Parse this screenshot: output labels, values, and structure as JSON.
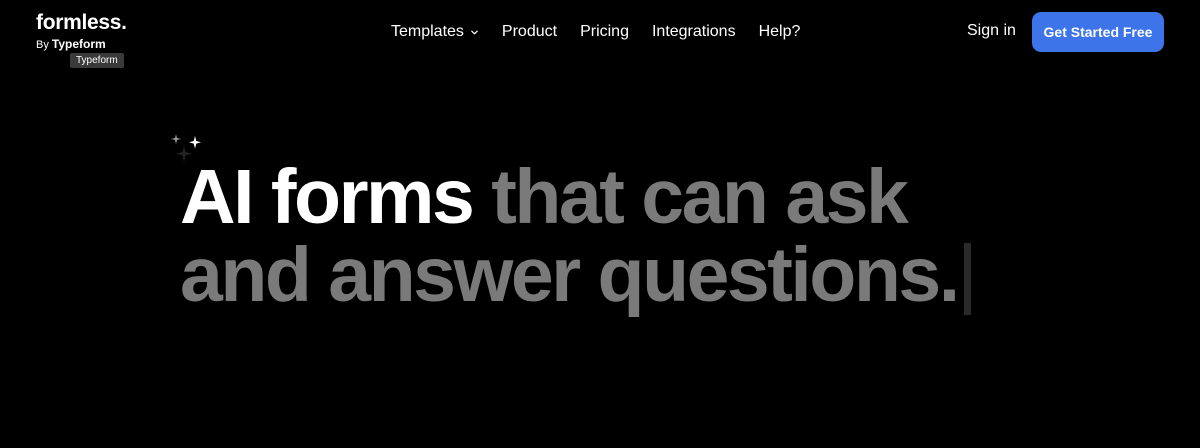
{
  "header": {
    "logo": {
      "word": "formless.",
      "by_prefix": "By",
      "by_brand": "Typeform",
      "tooltip": "Typeform"
    },
    "nav": [
      {
        "label": "Templates",
        "has_dropdown": true
      },
      {
        "label": "Product"
      },
      {
        "label": "Pricing"
      },
      {
        "label": "Integrations"
      },
      {
        "label": "Help?"
      }
    ],
    "sign_in_label": "Sign in",
    "cta_label": "Get Started Free"
  },
  "hero": {
    "line1_bright": "AI forms",
    "line1_dim": "that can ask",
    "line2_dim": "and answer questions."
  },
  "colors": {
    "background": "#000000",
    "text": "#ffffff",
    "text_dim": "#7a7a7a",
    "accent": "#3d74ea"
  },
  "icons": [
    "chevron-down-icon",
    "sparkle-icon",
    "text-cursor-icon"
  ]
}
